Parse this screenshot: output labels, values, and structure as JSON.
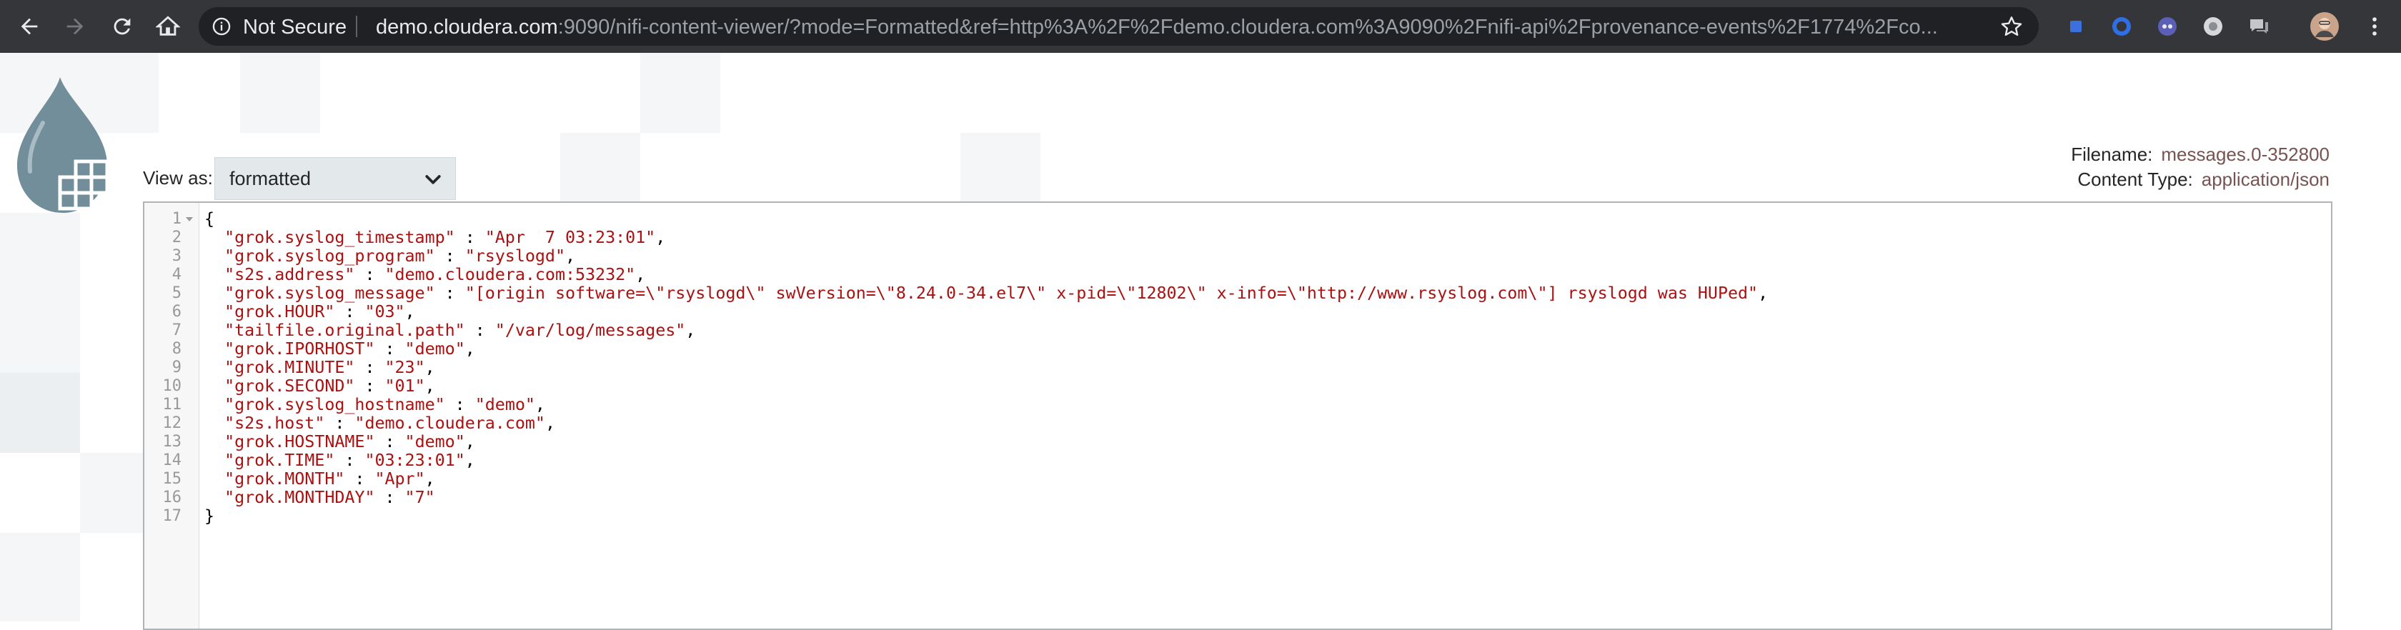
{
  "browser": {
    "security_label": "Not Secure",
    "url_host": "demo.cloudera.com",
    "url_rest": ":9090/nifi-content-viewer/?mode=Formatted&ref=http%3A%2F%2Fdemo.cloudera.com%3A9090%2Fnifi-api%2Fprovenance-events%2F1774%2Fco..."
  },
  "viewer": {
    "view_as_label": "View as:",
    "view_as_value": "formatted",
    "filename_label": "Filename:",
    "filename_value": "messages.0-352800",
    "content_type_label": "Content Type:",
    "content_type_value": "application/json"
  },
  "editor": {
    "lines": [
      {
        "n": "1",
        "text": "{"
      },
      {
        "n": "2",
        "key": "grok.syslog_timestamp",
        "value": "Apr  7 03:23:01",
        "comma": true
      },
      {
        "n": "3",
        "key": "grok.syslog_program",
        "value": "rsyslogd",
        "comma": true
      },
      {
        "n": "4",
        "key": "s2s.address",
        "value": "demo.cloudera.com:53232",
        "comma": true
      },
      {
        "n": "5",
        "key": "grok.syslog_message",
        "value": "[origin software=\\\"rsyslogd\\\" swVersion=\\\"8.24.0-34.el7\\\" x-pid=\\\"12802\\\" x-info=\\\"http://www.rsyslog.com\\\"] rsyslogd was HUPed",
        "comma": true
      },
      {
        "n": "6",
        "key": "grok.HOUR",
        "value": "03",
        "comma": true
      },
      {
        "n": "7",
        "key": "tailfile.original.path",
        "value": "/var/log/messages",
        "comma": true
      },
      {
        "n": "8",
        "key": "grok.IPORHOST",
        "value": "demo",
        "comma": true
      },
      {
        "n": "9",
        "key": "grok.MINUTE",
        "value": "23",
        "comma": true
      },
      {
        "n": "10",
        "key": "grok.SECOND",
        "value": "01",
        "comma": true
      },
      {
        "n": "11",
        "key": "grok.syslog_hostname",
        "value": "demo",
        "comma": true
      },
      {
        "n": "12",
        "key": "s2s.host",
        "value": "demo.cloudera.com",
        "comma": true
      },
      {
        "n": "13",
        "key": "grok.HOSTNAME",
        "value": "demo",
        "comma": true
      },
      {
        "n": "14",
        "key": "grok.TIME",
        "value": "03:23:01",
        "comma": true
      },
      {
        "n": "15",
        "key": "grok.MONTH",
        "value": "Apr",
        "comma": true
      },
      {
        "n": "16",
        "key": "grok.MONTHDAY",
        "value": "7",
        "comma": false
      },
      {
        "n": "17",
        "text": "}"
      }
    ]
  },
  "icons": {
    "back": "back-arrow-icon",
    "forward": "forward-arrow-icon",
    "reload": "reload-icon",
    "home": "home-icon",
    "info": "info-icon",
    "bookmark": "star-icon",
    "logo": "nifi-drop-logo",
    "select": "chevron-down-icon",
    "fold": "fold-arrow-icon"
  },
  "colors": {
    "chrome_bg": "#35363a",
    "omnibox_bg": "#202124",
    "json_text": "#aa1111",
    "meta_value": "#775351",
    "select_bg": "#e3e8eb"
  }
}
